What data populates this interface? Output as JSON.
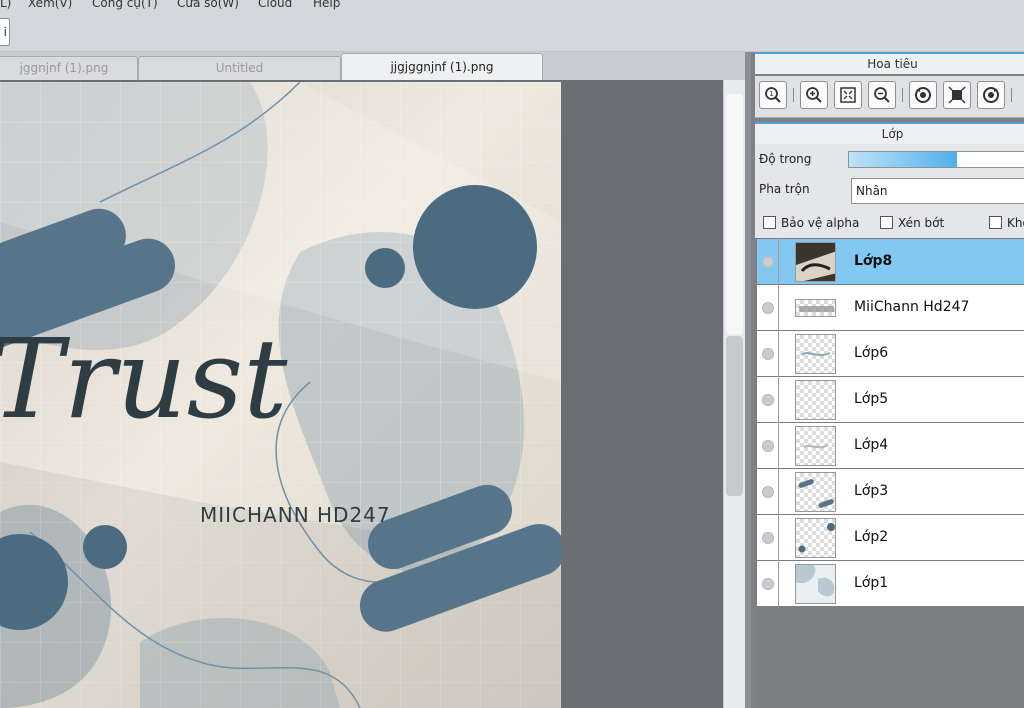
{
  "menu": {
    "items": [
      "L)",
      "Xem(V)",
      "Công cụ(T)",
      "Cửa sổ(W)",
      "Cloud",
      "Help"
    ]
  },
  "toolbar": {
    "partial_button_label": "i"
  },
  "tabs": [
    {
      "label": "jggnjnf (1).png",
      "active": false
    },
    {
      "label": "Untitled",
      "active": false
    },
    {
      "label": "jjgjggnjnf (1).png",
      "active": true
    }
  ],
  "canvas": {
    "title_text": "Trust",
    "watermark_text": "MIICHANN HD247"
  },
  "navigator": {
    "title": "Hoa tiêu",
    "tools": [
      "zoom-actual-icon",
      "zoom-in-icon",
      "fit-screen-icon",
      "zoom-out-icon",
      "rotate-left-icon",
      "fit-frame-icon",
      "rotate-right-icon"
    ]
  },
  "layers_panel": {
    "title": "Lớp",
    "opacity_label": "Độ trong",
    "opacity_value": 0.6,
    "blend_label": "Pha trộn",
    "blend_value": "Nhân",
    "checks": [
      {
        "label": "Bảo vệ alpha",
        "checked": false
      },
      {
        "label": "Xén bớt",
        "checked": false
      },
      {
        "label": "Khó",
        "checked": false
      }
    ],
    "layers": [
      {
        "name": "Lớp8",
        "selected": true
      },
      {
        "name": "MiiChann Hd247",
        "selected": false
      },
      {
        "name": "Lớp6",
        "selected": false
      },
      {
        "name": "Lớp5",
        "selected": false
      },
      {
        "name": "Lớp4",
        "selected": false
      },
      {
        "name": "Lớp3",
        "selected": false
      },
      {
        "name": "Lớp2",
        "selected": false
      },
      {
        "name": "Lớp1",
        "selected": false
      }
    ]
  },
  "colors": {
    "accent": "#4aa3df",
    "selected_layer": "#83c8f0",
    "canvas_bg": "#e6dfd3",
    "shape_blue": "#56758a"
  }
}
